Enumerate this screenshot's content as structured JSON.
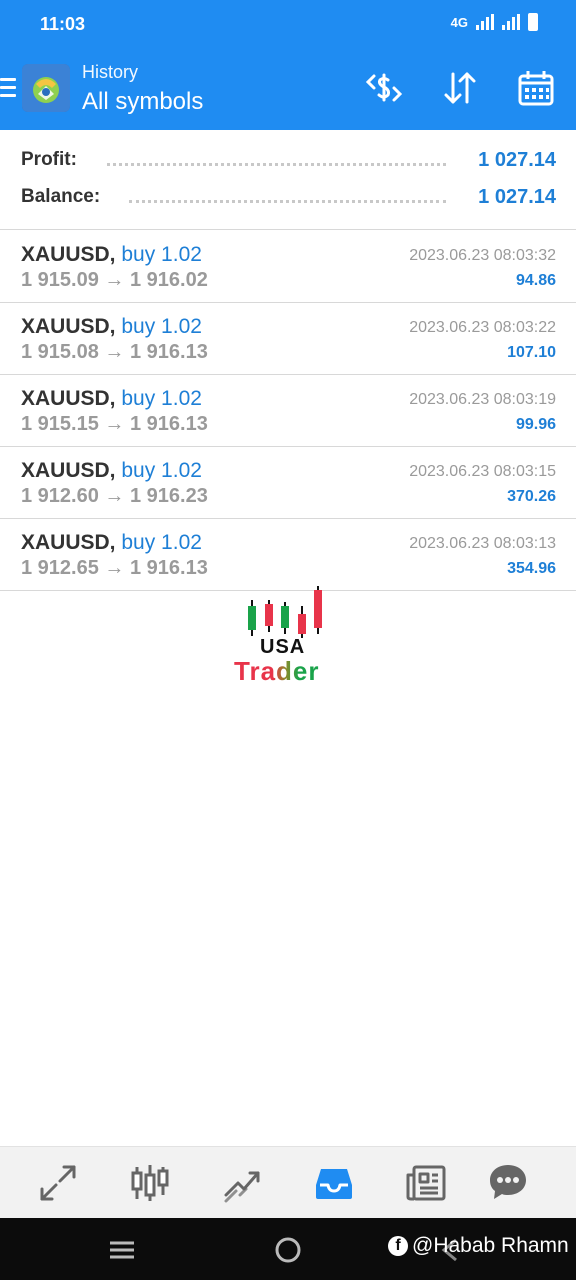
{
  "status_bar": {
    "time": "11:03",
    "network": "4G"
  },
  "header": {
    "subtitle": "History",
    "title": "All symbols"
  },
  "summary": {
    "profit_label": "Profit:",
    "profit_value": "1 027.14",
    "balance_label": "Balance:",
    "balance_value": "1 027.14"
  },
  "deals": [
    {
      "symbol": "XAUUSD,",
      "side": "buy 1.02",
      "open_price": "1 915.09",
      "close_price": "1 916.02",
      "time": "2023.06.23 08:03:32",
      "profit": "94.86"
    },
    {
      "symbol": "XAUUSD,",
      "side": "buy 1.02",
      "open_price": "1 915.08",
      "close_price": "1 916.13",
      "time": "2023.06.23 08:03:22",
      "profit": "107.10"
    },
    {
      "symbol": "XAUUSD,",
      "side": "buy 1.02",
      "open_price": "1 915.15",
      "close_price": "1 916.13",
      "time": "2023.06.23 08:03:19",
      "profit": "99.96"
    },
    {
      "symbol": "XAUUSD,",
      "side": "buy 1.02",
      "open_price": "1 912.60",
      "close_price": "1 916.23",
      "time": "2023.06.23 08:03:15",
      "profit": "370.26"
    },
    {
      "symbol": "XAUUSD,",
      "side": "buy 1.02",
      "open_price": "1 912.65",
      "close_price": "1 916.13",
      "time": "2023.06.23 08:03:13",
      "profit": "354.96"
    }
  ],
  "price_arrow": "→",
  "watermark": {
    "line1": "USA",
    "line2": "Trader"
  },
  "bottom_nav": {
    "items": [
      "trade-icon",
      "quotes-icon",
      "chart-icon",
      "history-icon",
      "news-icon",
      "chat-icon"
    ],
    "active": "history-icon"
  },
  "overlay_credit": "@Habab Rhamn",
  "colors": {
    "primary": "#1f8cf2",
    "accent_text": "#1e7fd6",
    "muted_text": "#9a9a9a",
    "watermark_red": "#e8344a",
    "watermark_green": "#1aa34a"
  }
}
